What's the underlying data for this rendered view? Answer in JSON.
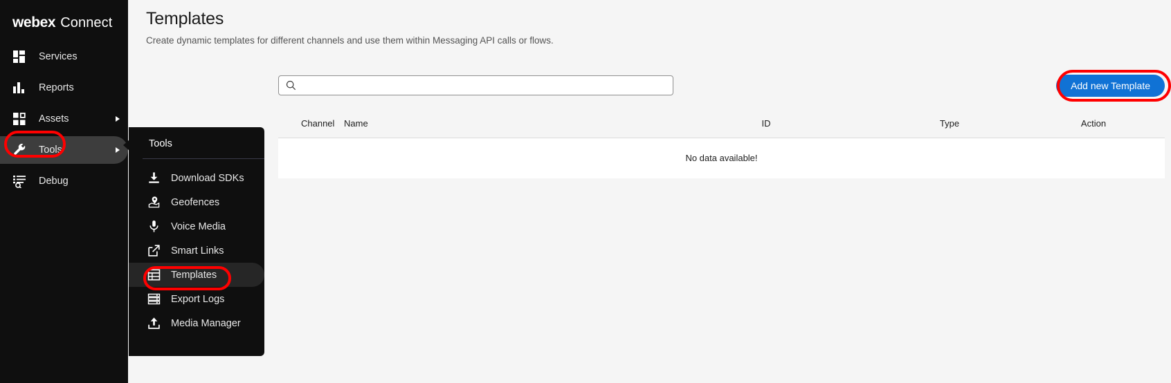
{
  "brand": {
    "name": "webex",
    "product": "Connect"
  },
  "sidebar": {
    "items": [
      {
        "label": "Services",
        "icon": "services-icon",
        "has_caret": false,
        "active": false
      },
      {
        "label": "Reports",
        "icon": "reports-icon",
        "has_caret": false,
        "active": false
      },
      {
        "label": "Assets",
        "icon": "assets-icon",
        "has_caret": true,
        "active": false
      },
      {
        "label": "Tools",
        "icon": "tools-wrench-icon",
        "has_caret": true,
        "active": true
      },
      {
        "label": "Debug",
        "icon": "debug-icon",
        "has_caret": false,
        "active": false
      }
    ]
  },
  "flyout": {
    "title": "Tools",
    "items": [
      {
        "label": "Download SDKs",
        "icon": "download-icon",
        "active": false
      },
      {
        "label": "Geofences",
        "icon": "geofence-map-pin-icon",
        "active": false
      },
      {
        "label": "Voice Media",
        "icon": "microphone-icon",
        "active": false
      },
      {
        "label": "Smart Links",
        "icon": "external-link-icon",
        "active": false
      },
      {
        "label": "Templates",
        "icon": "template-table-icon",
        "active": true
      },
      {
        "label": "Export Logs",
        "icon": "export-logs-icon",
        "active": false
      },
      {
        "label": "Media Manager",
        "icon": "upload-icon",
        "active": false
      }
    ]
  },
  "page": {
    "title": "Templates",
    "subtitle": "Create dynamic templates for different channels and use them within Messaging API calls or flows."
  },
  "search": {
    "value": "",
    "placeholder": "",
    "icon": "search-icon"
  },
  "toolbar": {
    "add_label": "Add new Template"
  },
  "table": {
    "columns": [
      "Channel",
      "Name",
      "ID",
      "Type",
      "Action"
    ],
    "rows": [],
    "empty_message": "No data available!"
  },
  "colors": {
    "sidebar_bg": "#0f0f0f",
    "sidebar_active": "#3d3d3d",
    "flyout_bg": "#0f0f0f",
    "flyout_active": "#262626",
    "primary_button": "#1072d5",
    "annotation_red": "#ff0000",
    "page_bg": "#f5f5f5",
    "table_bg": "#ffffff"
  },
  "annotations": [
    {
      "name": "tools-highlight",
      "target": "Tools"
    },
    {
      "name": "templates-highlight",
      "target": "Templates"
    },
    {
      "name": "add-new-template-highlight",
      "target": "Add new Template"
    }
  ]
}
